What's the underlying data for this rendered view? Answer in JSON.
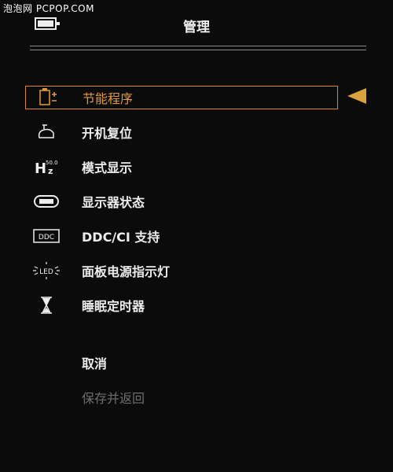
{
  "watermark": "泡泡网 PCPOP.COM",
  "header": {
    "title": "管理",
    "icon": "monitor-menu-icon"
  },
  "menu": {
    "items": [
      {
        "label": "节能程序",
        "icon": "power-saving-icon",
        "selected": true
      },
      {
        "label": "开机复位",
        "icon": "power-on-reset-icon",
        "selected": false
      },
      {
        "label": "模式显示",
        "icon": "mode-display-icon",
        "selected": false
      },
      {
        "label": "显示器状态",
        "icon": "monitor-status-icon",
        "selected": false
      },
      {
        "label": "DDC/CI 支持",
        "icon": "ddc-icon",
        "selected": false
      },
      {
        "label": "面板电源指示灯",
        "icon": "led-icon",
        "selected": false
      },
      {
        "label": "睡眠定时器",
        "icon": "hourglass-icon",
        "selected": false
      }
    ],
    "mode_icon_text": "50.0",
    "ddc_icon_text": "DDC",
    "led_icon_text": "LED"
  },
  "actions": {
    "cancel_label": "取消",
    "save_label": "保存并返回"
  },
  "colors": {
    "background": "#0b0b0b",
    "highlight": "#e39a3a",
    "pointer": "#d9a23a",
    "disabled": "#6e6e6e"
  }
}
